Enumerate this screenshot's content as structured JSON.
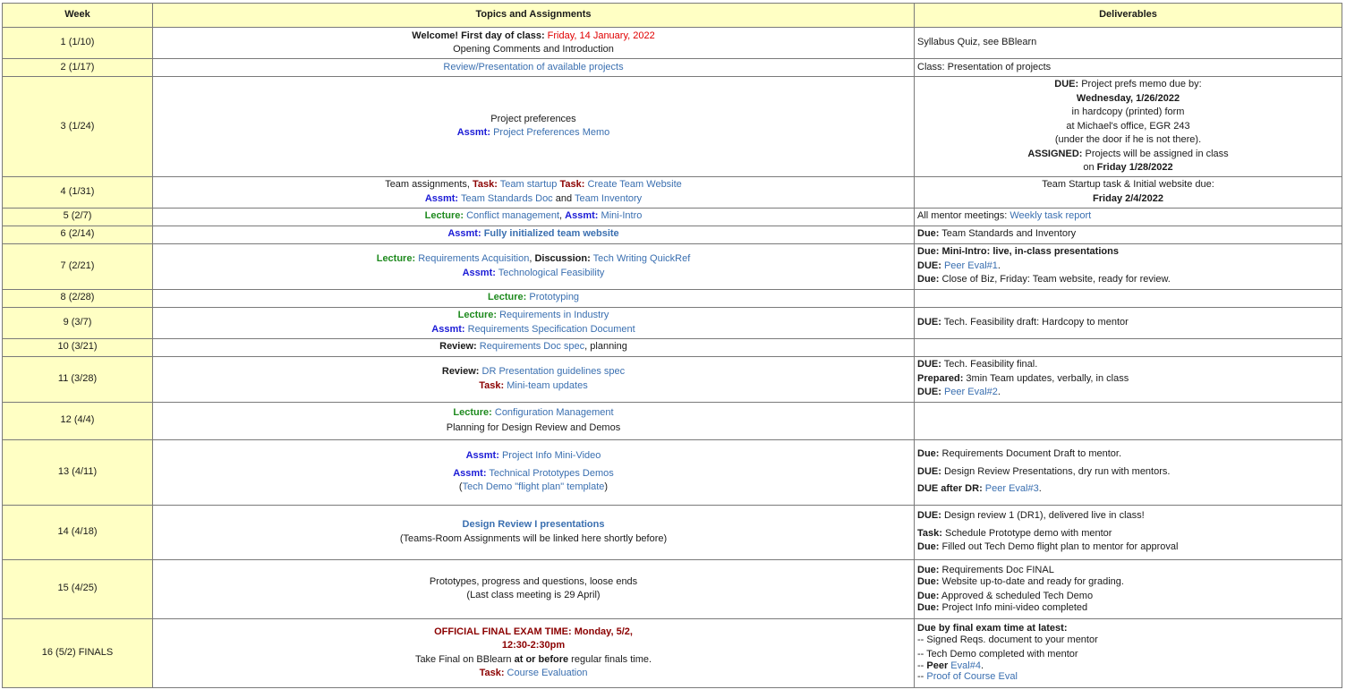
{
  "headers": {
    "week": "Week",
    "topics": "Topics and Assignments",
    "deliverables": "Deliverables"
  },
  "labels": {
    "task": "Task:",
    "assmt": "Assmt:",
    "lecture": "Lecture:",
    "discussion": "Discussion:",
    "review": "Review:",
    "due_upper": "DUE:",
    "due_mixed": "Due:",
    "assigned": "ASSIGNED:",
    "prepared": "Prepared:",
    "due_after_dr": "DUE after DR:"
  },
  "rows": [
    {
      "week": "1 (1/10)",
      "t": {
        "a": "Welcome! First day of class: ",
        "b": "Friday, 14 January, 2022",
        "c": "Opening Comments and Introduction"
      },
      "d": {
        "a": "Syllabus Quiz, see BBlearn"
      }
    },
    {
      "week": "2 (1/17)",
      "t": {
        "a": "Review/Presentation of available projects"
      },
      "d": {
        "a": "Class: Presentation of projects"
      }
    },
    {
      "week": "3 (1/24)",
      "t": {
        "a": "Project preferences",
        "b": "Project Preferences Memo"
      },
      "d": {
        "a": " Project prefs memo due by:",
        "b": "Wednesday, 1/26/2022",
        "c": "in hardcopy (printed) form",
        "e": "at Michael's office, EGR 243",
        "f": "(under the door if he is not there).",
        "g": " Projects will be assigned in class",
        "h": "on ",
        "i": "Friday 1/28/2022"
      }
    },
    {
      "week": "4 (1/31)",
      "t": {
        "a": "Team assignments, ",
        "b": "Team startup",
        "c": "Create Team Website",
        "e": "Team Standards Doc",
        "f": " and ",
        "g": "Team Inventory"
      },
      "d": {
        "a": "Team Startup task & Initial website due:",
        "b": "Friday 2/4/2022"
      }
    },
    {
      "week": "5 (2/7)",
      "t": {
        "a": "Conflict management",
        "b": ", ",
        "c": "Mini-Intro"
      },
      "d": {
        "a": "All mentor meetings: ",
        "b": "Weekly task report"
      }
    },
    {
      "week": "6 (2/14)",
      "t": {
        "a": "Fully initialized team website"
      },
      "d": {
        "a": " Team Standards and Inventory"
      }
    },
    {
      "week": "7 (2/21)",
      "t": {
        "a": "Requirements Acquisition",
        "b": ", ",
        "c": "Tech Writing QuickRef",
        "e": "Technological Feasibility"
      },
      "d": {
        "a": "Mini-Intro: live, in-class presentations",
        "b": "Peer Eval#1",
        "c": ".",
        "e": " Close of Biz, Friday: Team website, ready for review."
      }
    },
    {
      "week": "8 (2/28)",
      "t": {
        "a": "Prototyping"
      },
      "d": {}
    },
    {
      "week": "9 (3/7)",
      "t": {
        "a": "Requirements in Industry",
        "b": "Requirements Specification Document"
      },
      "d": {
        "a": " Tech. Feasibility draft: Hardcopy to mentor"
      }
    },
    {
      "week": "10 (3/21)",
      "t": {
        "a": "Requirements Doc spec",
        "b": ", planning"
      },
      "d": {}
    },
    {
      "week": "11 (3/28)",
      "t": {
        "a": "DR Presentation guidelines spec",
        "b": "Mini-team updates"
      },
      "d": {
        "a": " Tech. Feasibility final.",
        "b": " 3min Team updates, verbally, in class",
        "c": "Peer Eval#2",
        "e": "."
      }
    },
    {
      "week": "12 (4/4)",
      "t": {
        "a": "Configuration Management",
        "b": "Planning for Design Review and Demos"
      },
      "d": {}
    },
    {
      "week": "13 (4/11)",
      "t": {
        "a": "Project Info Mini-Video",
        "b": "Technical Prototypes Demos",
        "c": "(",
        "e": "Tech Demo \"flight plan\" template",
        "f": ")"
      },
      "d": {
        "a": " Requirements Document Draft to mentor.",
        "b": " Design Review Presentations, dry run with mentors.",
        "c": "Peer Eval#3",
        "e": "."
      }
    },
    {
      "week": "14 (4/18)",
      "t": {
        "a": "Design Review I presentations",
        "b": "(Teams-Room Assignments will be linked here shortly before)"
      },
      "d": {
        "a": " Design review 1 (DR1), delivered live in class!",
        "b": " Schedule Prototype demo with mentor",
        "c": " Filled out Tech Demo flight plan to mentor for approval"
      }
    },
    {
      "week": "15 (4/25)",
      "t": {
        "a": "Prototypes, progress and questions, loose ends",
        "b": "(Last class meeting is 29 April)"
      },
      "d": {
        "a": " Requirements Doc FINAL",
        "b": " Website up-to-date and ready for grading.",
        "c": " Approved & scheduled Tech Demo",
        "e": " Project Info mini-video completed"
      }
    },
    {
      "week": "16 (5/2) FINALS",
      "t": {
        "a": "OFFICIAL FINAL EXAM TIME: Monday, 5/2,",
        "b": "12:30-2:30pm",
        "c": "Take Final on BBlearn ",
        "e": "at or before",
        "f": " regular finals time.",
        "g": "Course Evaluation"
      },
      "d": {
        "a": "Due by final exam time at latest:",
        "b": "-- Signed Reqs. document to your mentor",
        "c": "-- Tech Demo completed with mentor",
        "e": "-- ",
        "f": "Peer",
        "g": " Eval#4",
        "h": ".",
        "i": "-- ",
        "j": "Proof of Course Eval"
      }
    }
  ]
}
